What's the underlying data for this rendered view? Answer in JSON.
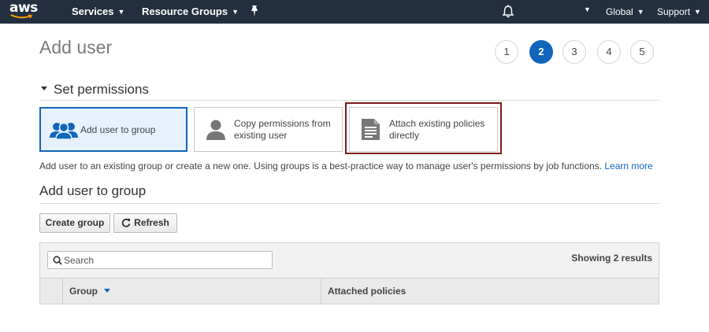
{
  "nav": {
    "logo": "aws",
    "services": "Services",
    "resource_groups": "Resource Groups",
    "region": "Global",
    "support": "Support"
  },
  "page": {
    "title": "Add user",
    "steps": [
      "1",
      "2",
      "3",
      "4",
      "5"
    ],
    "active_step": 2
  },
  "permissions": {
    "heading": "Set permissions",
    "options": [
      {
        "label": "Add user to group",
        "icon": "group-icon",
        "selected": true
      },
      {
        "label": "Copy permissions from existing user",
        "icon": "user-icon",
        "selected": false
      },
      {
        "label": "Attach existing policies directly",
        "icon": "document-icon",
        "selected": false
      }
    ],
    "description": "Add user to an existing group or create a new one. Using groups is a best-practice way to manage user's permissions by job functions.",
    "learn_more": "Learn more"
  },
  "group_section": {
    "heading": "Add user to group",
    "create_button": "Create group",
    "refresh_button": "Refresh",
    "search_placeholder": "Search",
    "results_text": "Showing 2 results",
    "columns": [
      "Group",
      "Attached policies"
    ]
  },
  "colors": {
    "nav_bg": "#232f3e",
    "accent": "#1166bb",
    "highlight_border": "#7d1a1f"
  }
}
